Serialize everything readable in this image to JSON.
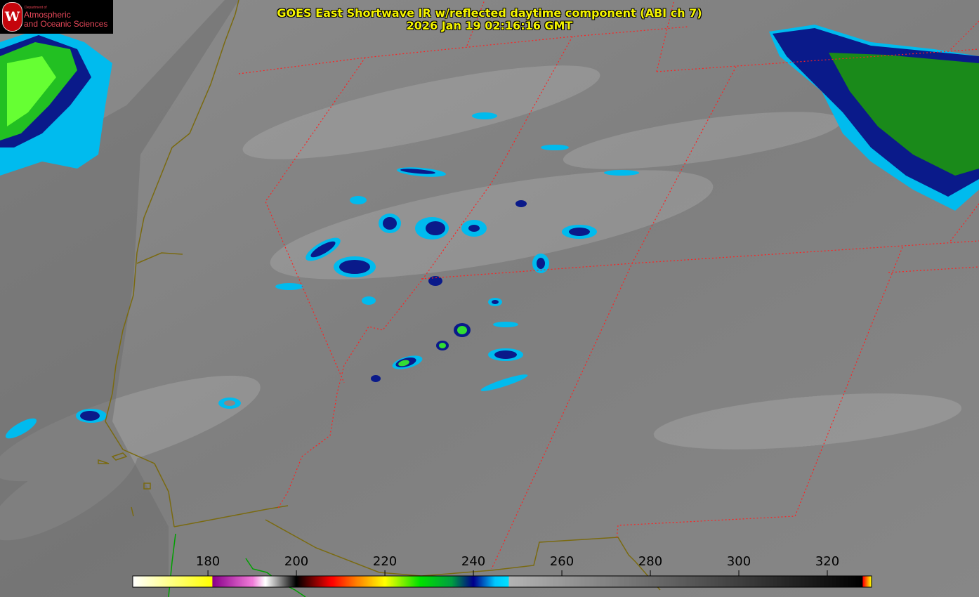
{
  "title": {
    "line1": "GOES East Shortwave IR w/reflected daytime component (ABI ch 7)",
    "line2": "2026 Jan 19 02:16:16 GMT"
  },
  "logo": {
    "dept": "Department of",
    "line1": "Atmospheric",
    "line2": "and Oceanic Sciences",
    "seal_letter": "W"
  },
  "colorbar": {
    "min": 163,
    "max": 330,
    "ticks": [
      "180",
      "200",
      "220",
      "240",
      "260",
      "280",
      "300",
      "320"
    ],
    "tick_values": [
      180,
      200,
      220,
      240,
      260,
      280,
      300,
      320
    ],
    "stops": [
      {
        "v": 163,
        "c": "#ffffff"
      },
      {
        "v": 181,
        "c": "#ffff00"
      },
      {
        "v": 181,
        "c": "#8a008a"
      },
      {
        "v": 190,
        "c": "#f07ad8"
      },
      {
        "v": 193,
        "c": "#ffffff"
      },
      {
        "v": 200,
        "c": "#000000"
      },
      {
        "v": 208,
        "c": "#ff0000"
      },
      {
        "v": 214,
        "c": "#ff8800"
      },
      {
        "v": 220,
        "c": "#ffff00"
      },
      {
        "v": 228,
        "c": "#00e000"
      },
      {
        "v": 235,
        "c": "#00a040"
      },
      {
        "v": 240,
        "c": "#00008a"
      },
      {
        "v": 245,
        "c": "#00c8ff"
      },
      {
        "v": 248,
        "c": "#00e0ff"
      },
      {
        "v": 248,
        "c": "#b4b4b4"
      },
      {
        "v": 328,
        "c": "#000000"
      },
      {
        "v": 328,
        "c": "#ff0000"
      },
      {
        "v": 330,
        "c": "#ffff00"
      }
    ]
  },
  "colors": {
    "state_border": "#ff2020",
    "coastline_land": "#7a6a10",
    "coastline_green": "#00a000",
    "title": "#f5f500"
  }
}
